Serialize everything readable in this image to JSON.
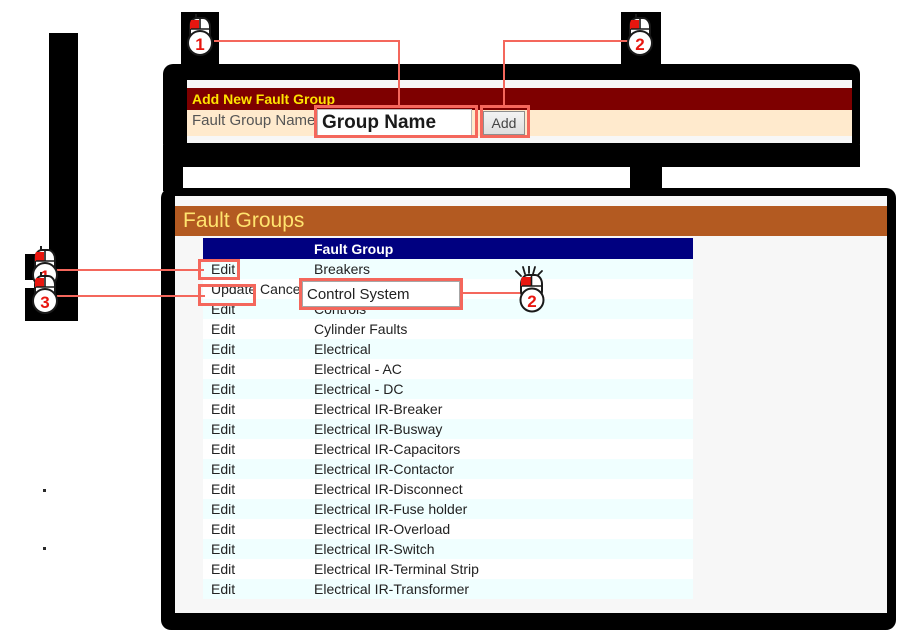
{
  "add_panel": {
    "title": "Add New Fault Group",
    "field_label": "Fault Group Name",
    "input_value": "Group Name",
    "input_placeholder": "Group Name",
    "add_button": "Add"
  },
  "groups_panel": {
    "title": "Fault Groups",
    "columns": [
      "",
      "Fault Group"
    ],
    "edit_label": "Edit",
    "update_label": "Update",
    "cancel_label": "Cance",
    "editing_value": "Control System",
    "rows": [
      {
        "cmd": "Edit",
        "name": "Breakers",
        "editing": false
      },
      {
        "cmd": "Update",
        "name": "Control System",
        "editing": true
      },
      {
        "cmd": "Edit",
        "name": "Controls",
        "editing": false
      },
      {
        "cmd": "Edit",
        "name": "Cylinder Faults",
        "editing": false
      },
      {
        "cmd": "Edit",
        "name": "Electrical",
        "editing": false
      },
      {
        "cmd": "Edit",
        "name": "Electrical - AC",
        "editing": false
      },
      {
        "cmd": "Edit",
        "name": "Electrical - DC",
        "editing": false
      },
      {
        "cmd": "Edit",
        "name": "Electrical IR-Breaker",
        "editing": false
      },
      {
        "cmd": "Edit",
        "name": "Electrical IR-Busway",
        "editing": false
      },
      {
        "cmd": "Edit",
        "name": "Electrical IR-Capacitors",
        "editing": false
      },
      {
        "cmd": "Edit",
        "name": "Electrical IR-Contactor",
        "editing": false
      },
      {
        "cmd": "Edit",
        "name": "Electrical IR-Disconnect",
        "editing": false
      },
      {
        "cmd": "Edit",
        "name": "Electrical IR-Fuse holder",
        "editing": false
      },
      {
        "cmd": "Edit",
        "name": "Electrical IR-Overload",
        "editing": false
      },
      {
        "cmd": "Edit",
        "name": "Electrical IR-Switch",
        "editing": false
      },
      {
        "cmd": "Edit",
        "name": "Electrical IR-Terminal Strip",
        "editing": false
      },
      {
        "cmd": "Edit",
        "name": "Electrical IR-Transformer",
        "editing": false
      }
    ]
  },
  "annotations": {
    "badges": [
      {
        "number": "1",
        "name": "step-1-top",
        "clicking": false
      },
      {
        "number": "2",
        "name": "step-2-top",
        "clicking": false
      },
      {
        "number": "1",
        "name": "step-1-left",
        "clicking": false
      },
      {
        "number": "3",
        "name": "step-3-left",
        "clicking": false
      },
      {
        "number": "2",
        "name": "step-2-inline",
        "clicking": true
      }
    ]
  },
  "colors": {
    "add_header_bg": "#7e0000",
    "add_header_text": "#ffe400",
    "add_body_bg": "#ffeacd",
    "groups_header_bg": "#b35a21",
    "groups_header_text": "#ffe36e",
    "table_header_bg": "#000080",
    "row_alt_bg": "#f0ffff",
    "annotation": "#f4675c",
    "mask": "#000000"
  }
}
